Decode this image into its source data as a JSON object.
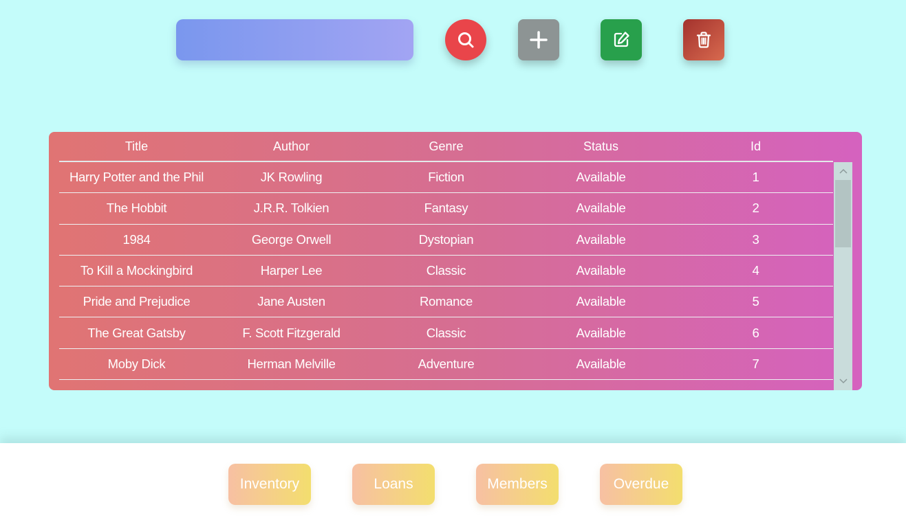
{
  "search": {
    "value": "",
    "placeholder": ""
  },
  "toolbar": {
    "search_button_icon": "search-icon",
    "add_button_icon": "plus-icon",
    "edit_button_icon": "edit-icon",
    "delete_button_icon": "trash-icon"
  },
  "table": {
    "headers": [
      "Title",
      "Author",
      "Genre",
      "Status",
      "Id"
    ],
    "rows": [
      [
        "Harry Potter and the Phil",
        "JK Rowling",
        "Fiction",
        "Available",
        "1"
      ],
      [
        "The Hobbit",
        "J.R.R. Tolkien",
        "Fantasy",
        "Available",
        "2"
      ],
      [
        "1984",
        "George Orwell",
        "Dystopian",
        "Available",
        "3"
      ],
      [
        "To Kill a Mockingbird",
        "Harper Lee",
        "Classic",
        "Available",
        "4"
      ],
      [
        "Pride and Prejudice",
        "Jane Austen",
        "Romance",
        "Available",
        "5"
      ],
      [
        "The Great Gatsby",
        "F. Scott Fitzgerald",
        "Classic",
        "Available",
        "6"
      ],
      [
        "Moby Dick",
        "Herman Melville",
        "Adventure",
        "Available",
        "7"
      ]
    ]
  },
  "nav": {
    "inventory": "Inventory",
    "loans": "Loans",
    "members": "Members",
    "overdue": "Overdue"
  },
  "colors": {
    "background": "#c4fcfa",
    "search_button": "#e9454a",
    "add_button": "#8d9494",
    "edit_button": "#28a04c",
    "delete_button": "#b8443a"
  }
}
